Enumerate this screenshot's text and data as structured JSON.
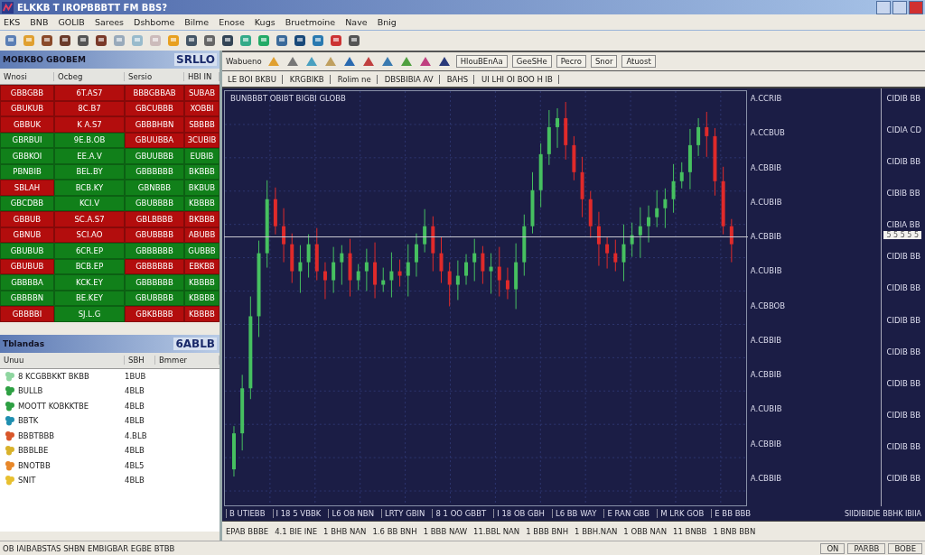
{
  "window": {
    "title": "ELKKB T IROPBBBTT FM BBS?"
  },
  "menu": [
    "EKS",
    "BNB",
    "GOLIB",
    "Sarees",
    "Dshbome",
    "Bilme",
    "Enose",
    "Kugs",
    "Bruetmoine",
    "Nave",
    "Bnig"
  ],
  "market_watch": {
    "title": "MOBKBO GBOBEM",
    "badge": "SRLLO",
    "columns": [
      "Wnosi",
      "Ocbeg",
      "Sersio",
      "HBI IN"
    ],
    "rows": [
      [
        {
          "text": "GBBGBB",
          "color": "#b30d0d"
        },
        {
          "text": "6T.AS7",
          "color": "#b30d0d"
        },
        {
          "text": "BBBGBBAB",
          "color": "#b30d0d"
        },
        {
          "text": "SUBAB",
          "color": "#b30d0d"
        }
      ],
      [
        {
          "text": "GBUKUB",
          "color": "#b30d0d"
        },
        {
          "text": "8C.B7",
          "color": "#b30d0d"
        },
        {
          "text": "GBCUBBB",
          "color": "#b30d0d"
        },
        {
          "text": "XOBBI",
          "color": "#b30d0d"
        }
      ],
      [
        {
          "text": "GBBUK",
          "color": "#b30d0d"
        },
        {
          "text": "K A.S7",
          "color": "#b30d0d"
        },
        {
          "text": "GBBBHBN",
          "color": "#b30d0d"
        },
        {
          "text": "SBBBB",
          "color": "#b30d0d"
        }
      ],
      [
        {
          "text": "GBRBUI",
          "color": "#11801a"
        },
        {
          "text": "9E.B.OB",
          "color": "#11801a"
        },
        {
          "text": "GBUUBBA",
          "color": "#b30d0d"
        },
        {
          "text": "3CUBIB",
          "color": "#b30d0d"
        }
      ],
      [
        {
          "text": "GBBKOI",
          "color": "#11801a"
        },
        {
          "text": "EE.A.V",
          "color": "#11801a"
        },
        {
          "text": "GBUUBBB",
          "color": "#11801a"
        },
        {
          "text": "EUBIB",
          "color": "#11801a"
        }
      ],
      [
        {
          "text": "PBNBIB",
          "color": "#11801a"
        },
        {
          "text": "BEL.BY",
          "color": "#11801a"
        },
        {
          "text": "GBBBBBB",
          "color": "#11801a"
        },
        {
          "text": "BKBBB",
          "color": "#11801a"
        }
      ],
      [
        {
          "text": "SBLAH",
          "color": "#b30d0d"
        },
        {
          "text": "BCB.KY",
          "color": "#11801a"
        },
        {
          "text": "GBNBBB",
          "color": "#11801a"
        },
        {
          "text": "BKBUB",
          "color": "#11801a"
        }
      ],
      [
        {
          "text": "GBCDBB",
          "color": "#11801a"
        },
        {
          "text": "KCI.V",
          "color": "#11801a"
        },
        {
          "text": "GBUBBBB",
          "color": "#11801a"
        },
        {
          "text": "KBBBB",
          "color": "#11801a"
        }
      ],
      [
        {
          "text": "GBBUB",
          "color": "#b30d0d"
        },
        {
          "text": "SC.A.S7",
          "color": "#b30d0d"
        },
        {
          "text": "GBLBBBB",
          "color": "#b30d0d"
        },
        {
          "text": "BKBBB",
          "color": "#b30d0d"
        }
      ],
      [
        {
          "text": "GBNUB",
          "color": "#b30d0d"
        },
        {
          "text": "SCI.AO",
          "color": "#b30d0d"
        },
        {
          "text": "GBUBBBB",
          "color": "#b30d0d"
        },
        {
          "text": "ABUBB",
          "color": "#b30d0d"
        }
      ],
      [
        {
          "text": "GBUBUB",
          "color": "#11801a"
        },
        {
          "text": "6CR.EP",
          "color": "#11801a"
        },
        {
          "text": "GBBBBBB",
          "color": "#11801a"
        },
        {
          "text": "GUBBB",
          "color": "#11801a"
        }
      ],
      [
        {
          "text": "GBUBUB",
          "color": "#b30d0d"
        },
        {
          "text": "BCB.EP",
          "color": "#11801a"
        },
        {
          "text": "GBBBBBB",
          "color": "#b30d0d"
        },
        {
          "text": "EBKBB",
          "color": "#b30d0d"
        }
      ],
      [
        {
          "text": "GBBBBA",
          "color": "#11801a"
        },
        {
          "text": "KCK.EY",
          "color": "#11801a"
        },
        {
          "text": "GBBBBBB",
          "color": "#11801a"
        },
        {
          "text": "KBBBB",
          "color": "#11801a"
        }
      ],
      [
        {
          "text": "GBBBBN",
          "color": "#11801a"
        },
        {
          "text": "BE.KEY",
          "color": "#11801a"
        },
        {
          "text": "GBUBBBB",
          "color": "#11801a"
        },
        {
          "text": "KBBBB",
          "color": "#11801a"
        }
      ],
      [
        {
          "text": "GBBBBI",
          "color": "#b30d0d"
        },
        {
          "text": "SJ.L.G",
          "color": "#11801a"
        },
        {
          "text": "GBKBBBB",
          "color": "#b30d0d"
        },
        {
          "text": "KBBBB",
          "color": "#b30d0d"
        }
      ]
    ]
  },
  "navigator": {
    "title": "Tblandas",
    "badge": "6ABLB",
    "columns": [
      "Unuu",
      "SBH",
      "Bmmer"
    ],
    "items": [
      {
        "name": "8 KCGBBKKT BKBB",
        "value": "1BUB",
        "color": "#8fd6a0"
      },
      {
        "name": "BULLB",
        "value": "4BLB",
        "color": "#2ea043"
      },
      {
        "name": "MOOTT KOBKKTBE",
        "value": "4BLB",
        "color": "#2ea043"
      },
      {
        "name": "BBTK",
        "value": "4BLB",
        "color": "#1f8fb0"
      },
      {
        "name": "BBBTBBB",
        "value": "4.BLB",
        "color": "#d9572b"
      },
      {
        "name": "BBBLBE",
        "value": "4BLB",
        "color": "#d9b22b"
      },
      {
        "name": "BNOTBB",
        "value": "4BL5",
        "color": "#e8882a"
      },
      {
        "name": "SNIT",
        "value": "4BLB",
        "color": "#e8c030"
      }
    ]
  },
  "chart_toolbar": {
    "label": "Wabueno",
    "items": [
      "HlouBEnAa",
      "GeeSHe",
      "Pecro",
      "Snor",
      "Atuost"
    ]
  },
  "chart_info": [
    "LE BOI BKBU",
    "KRGBIKB",
    "Rolim ne",
    "DBSBIBIA AV",
    "BAHS",
    "UI LHI OI BOO H IB"
  ],
  "chart": {
    "title": "BUNBBBT OBIBT BIGBI GLOBB",
    "inner_labels": [
      "A.CCRIB",
      "A.CCBUB",
      "A.CBBIB",
      "A.CUBIB",
      "A.CBBIB",
      "A.CUBIB",
      "A.CBBOB",
      "A.CBBIB",
      "A.CBBIB",
      "A.CUBIB",
      "A.CBBIB",
      "A.CBBIB"
    ],
    "axis_labels": [
      "CIDIB BB",
      "CIDIA CD",
      "CIDIB BB",
      "CIBIB BB",
      "CIBIA BB",
      "CIDIB BB",
      "CIDIB BB",
      "CIDIB BB",
      "CIDIB BB",
      "CIDIB BB",
      "CIDIB BB",
      "CIDIB BB",
      "CIDIB BB"
    ],
    "cursor_label": "5 5 5 5 5",
    "time_labels": [
      "B UTIEBB",
      "I 18 5 VBBK",
      "L6 OB NBN",
      "LRTY GBIN",
      "8 1 OO GBBT",
      "I 18 OB GBH",
      "L6 BB WAY",
      "E RAN GBB",
      "M LRK GOB",
      "E BB BBB"
    ],
    "time_corner": "SIIDIBIDIE BBHK IBIIA"
  },
  "periods": [
    "EPAB BBBE",
    "4.1 BIE INE",
    "1 BHB NAN",
    "1.6 BB BNH",
    "1 BBB NAW",
    "11.BBL NAN",
    "1 BBB BNH",
    "1 BBH.NAN",
    "1 OBB NAN",
    "11 BNBB",
    "1 BNB BBN"
  ],
  "status_bar": {
    "text": "OB IAIBABSTAS SHBN EMBIGBAR EGBE BTBB",
    "cells": [
      "ON",
      "PARBB",
      "BOBE"
    ]
  }
}
